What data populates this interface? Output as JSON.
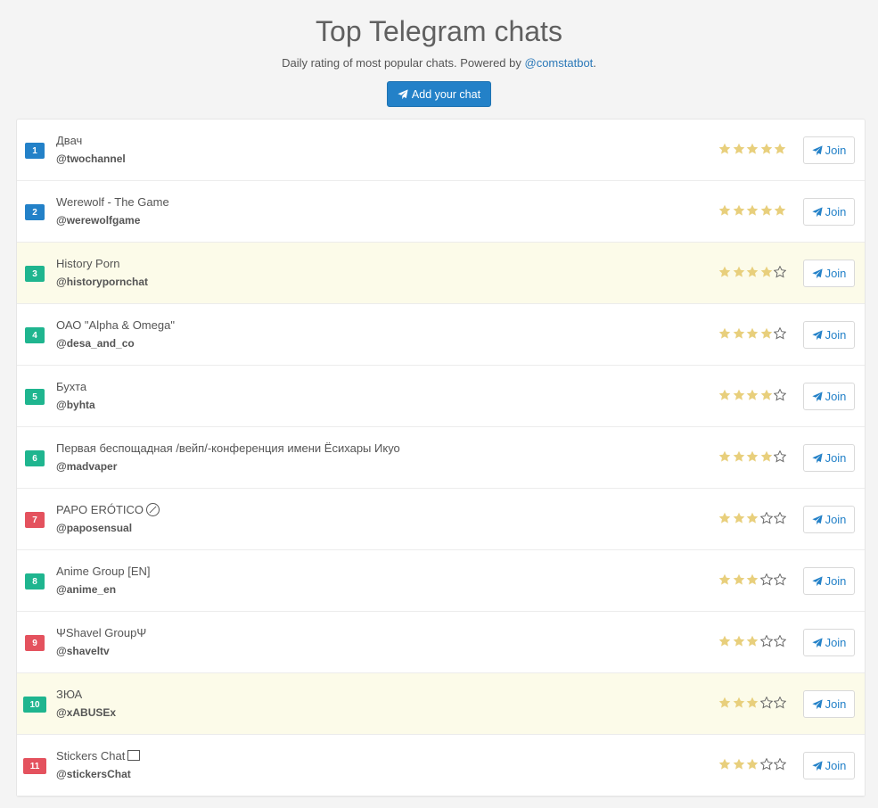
{
  "header": {
    "title": "Top Telegram chats",
    "subtitle_prefix": "Daily rating of most popular chats. Powered by ",
    "bot_link": "@comstatbot",
    "subtitle_suffix": ".",
    "add_button_label": "Add your chat"
  },
  "colors": {
    "accent": "#2381c8",
    "rank_blue": "#2381c8",
    "rank_green": "#1fb58f",
    "rank_red": "#e4525e",
    "star_filled": "#e8cf7c",
    "highlight_row": "#fcfbe9"
  },
  "join_label": "Join",
  "chats": [
    {
      "rank": "1",
      "rank_color": "blue",
      "name": "Двач",
      "handle": "@twochannel",
      "rating": 5,
      "highlight": false
    },
    {
      "rank": "2",
      "rank_color": "blue",
      "name": "Werewolf - The Game",
      "handle": "@werewolfgame",
      "rating": 5,
      "highlight": false
    },
    {
      "rank": "3",
      "rank_color": "green",
      "name": "History Porn",
      "handle": "@historypornchat",
      "rating": 4,
      "highlight": true
    },
    {
      "rank": "4",
      "rank_color": "green",
      "name": "ОАО \"Alpha & Omega\"",
      "handle": "@desa_and_co",
      "rating": 4,
      "highlight": false
    },
    {
      "rank": "5",
      "rank_color": "green",
      "name": "Бухта",
      "handle": "@byhta",
      "rating": 4,
      "highlight": false
    },
    {
      "rank": "6",
      "rank_color": "green",
      "name": "Первая беспощадная /вейп/-конференция имени Ёсихары Икуо",
      "handle": "@madvaper",
      "rating": 4,
      "highlight": false
    },
    {
      "rank": "7",
      "rank_color": "red",
      "name": "PAPO ERÓTICO",
      "name_suffix_icon": "18-circle-icon",
      "handle": "@paposensual",
      "rating": 3,
      "highlight": false
    },
    {
      "rank": "8",
      "rank_color": "green",
      "name": "Anime Group [EN]",
      "handle": "@anime_en",
      "rating": 3,
      "highlight": false
    },
    {
      "rank": "9",
      "rank_color": "red",
      "name": "ΨShavel GroupΨ",
      "handle": "@shaveltv",
      "rating": 3,
      "highlight": false
    },
    {
      "rank": "10",
      "rank_color": "green",
      "name": "ЗЮА",
      "handle": "@xABUSEx",
      "rating": 3,
      "highlight": true
    },
    {
      "rank": "11",
      "rank_color": "red",
      "name": "Stickers Chat",
      "name_suffix_icon": "missing-glyph-icon",
      "handle": "@stickersChat",
      "rating": 3,
      "highlight": false
    }
  ]
}
